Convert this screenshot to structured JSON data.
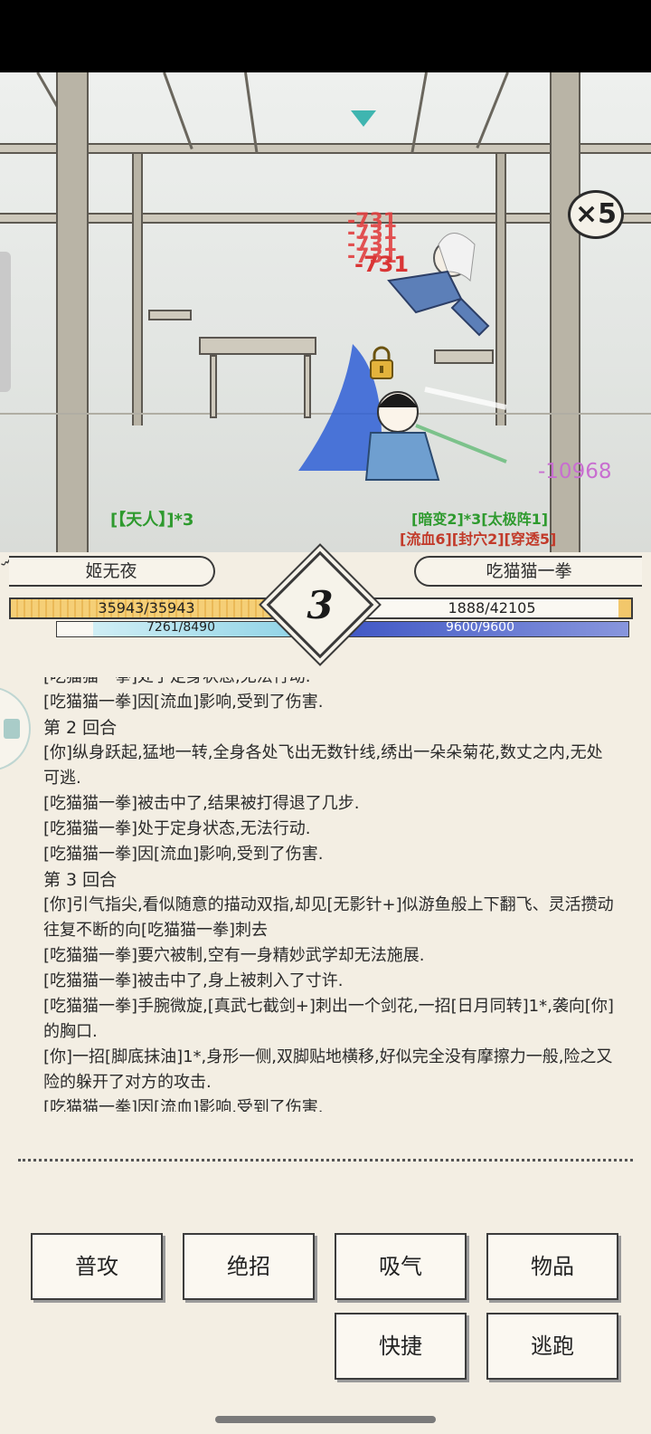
{
  "battle": {
    "speed_multiplier": "×5",
    "damage_on_enemy": "-731",
    "damage_on_enemy_stack": [
      "-731",
      "-731",
      "-731",
      "-731"
    ],
    "damage_on_player": "-10968",
    "player_status": "[【天人】]*3",
    "enemy_status_buffs": "[暗变2]*3[太极阵1]",
    "enemy_status_debuffs": "[流血6][封穴2][穿透5]"
  },
  "player": {
    "name": "姬无夜",
    "hp_text": "35943/35943",
    "hp_fraction": 1.0,
    "mp_text": "7261/8490",
    "mp_fraction": 0.855
  },
  "enemy": {
    "name": "吃猫猫一拳",
    "hp_text": "1888/42105",
    "hp_fraction": 0.045,
    "mp_text": "9600/9600",
    "mp_fraction": 1.0
  },
  "round": {
    "number": "3"
  },
  "log": {
    "lines": [
      "[吃猫猫一拳]处于定身状态,无法行动.",
      "[吃猫猫一拳]因[流血]影响,受到了伤害.",
      "第 2 回合",
      "[你]纵身跃起,猛地一转,全身各处飞出无数针线,绣出一朵朵菊花,数丈之内,无处可逃.",
      "[吃猫猫一拳]被击中了,结果被打得退了几步.",
      "[吃猫猫一拳]处于定身状态,无法行动.",
      "[吃猫猫一拳]因[流血]影响,受到了伤害.",
      "第 3 回合",
      "[你]引气指尖,看似随意的描动双指,却见[无影针+]似游鱼般上下翻飞、灵活攒动往复不断的向[吃猫猫一拳]刺去",
      "[吃猫猫一拳]要穴被制,空有一身精妙武学却无法施展.",
      "[吃猫猫一拳]被击中了,身上被刺入了寸许.",
      "[吃猫猫一拳]手腕微旋,[真武七截剑+]刺出一个剑花,一招[日月同转]1*,袭向[你]的胸口.",
      "[你]一招[脚底抹油]1*,身形一侧,双脚贴地横移,好似完全没有摩擦力一般,险之又险的躲开了对方的攻击.",
      "[吃猫猫一拳]因[流血]影响,受到了伤害."
    ]
  },
  "actions": {
    "attack": "普攻",
    "ultimate": "绝招",
    "breathe": "吸气",
    "items": "物品",
    "quick": "快捷",
    "flee": "逃跑"
  },
  "colors": {
    "hp_player": "#f2c76b",
    "hp_enemy": "#f2c76b",
    "mp_player": "#8fd3e6",
    "mp_enemy": "#5a6fd1",
    "status_green": "#2e9a2e",
    "status_red": "#c23a2a",
    "damage_red": "#d93535",
    "damage_purple": "#c86ed0"
  }
}
